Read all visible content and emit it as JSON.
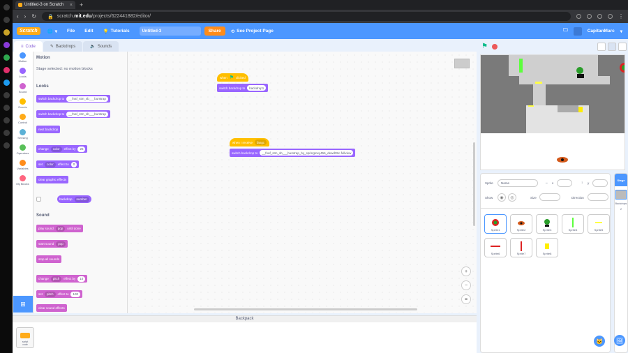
{
  "browser": {
    "tab_title": "Untitled-3 on Scratch",
    "tab_close": "×",
    "new_tab": "+",
    "url_prefix": "scratch.",
    "url_host": "mit.edu",
    "url_path": "/projects/622441882/editor/"
  },
  "menubar": {
    "logo": "Scratch",
    "file": "File",
    "edit": "Edit",
    "tutorials": "Tutorials",
    "project_title": "Untitled-3",
    "share": "Share",
    "see_project": "See Project Page",
    "username": "CapitanMarc"
  },
  "editor_tabs": {
    "code": "Code",
    "costumes": "Backdrops",
    "sounds": "Sounds"
  },
  "categories": [
    {
      "label": "Motion",
      "color": "#4c97ff"
    },
    {
      "label": "Looks",
      "color": "#9966ff"
    },
    {
      "label": "Sound",
      "color": "#cf63cf"
    },
    {
      "label": "Events",
      "color": "#ffbf00"
    },
    {
      "label": "Control",
      "color": "#ffab19"
    },
    {
      "label": "Sensing",
      "color": "#5cb1d6"
    },
    {
      "label": "Operators",
      "color": "#59c059"
    },
    {
      "label": "Variables",
      "color": "#ff8c1a"
    },
    {
      "label": "My Blocks",
      "color": "#ff6680"
    }
  ],
  "palette": {
    "motion_heading": "Motion",
    "motion_note": "Stage selected: no motion blocks",
    "looks_heading": "Looks",
    "sound_heading": "Sound",
    "b1": "switch backdrop to",
    "b1_val": "__fnaf_stm_sb___bumtrap",
    "b2": "switch backdrop to",
    "b2_val": "__fnaf_stm_sb___bumtrap",
    "b3": "next backdrop",
    "b4a": "change",
    "b4_dd": "color",
    "b4b": "effect by",
    "b4_val": "25",
    "b5a": "set",
    "b5_dd": "color",
    "b5b": "effect to",
    "b5_val": "0",
    "b6": "clear graphic effects",
    "b7": "backdrop",
    "b7_dd": "number",
    "s1": "play sound",
    "s1_dd": "pop",
    "s1b": "until done",
    "s2": "start sound",
    "s2_dd": "pop",
    "s3": "stop all sounds",
    "s4a": "change",
    "s4_dd": "pitch",
    "s4b": "effect by",
    "s4_val": "10",
    "s5a": "set",
    "s5_dd": "pitch",
    "s5b": "effect to",
    "s5_val": "100",
    "s6": "clear sound effects"
  },
  "script": {
    "hat1_when": "when",
    "hat1_clicked": "clicked",
    "blk1": "switch backdrop to",
    "blk1_val": "backdrop1",
    "hat2": "when I receive",
    "hat2_val": "fangc",
    "blk2": "switch backdrop to",
    "blk2_val": "__fnaf_stm_sb___bumtrap_by_springtoxy456_dewd35c-fullview"
  },
  "zoom": {
    "in": "+",
    "out": "−",
    "reset": "="
  },
  "backpack": {
    "title": "Backpack",
    "item_label": "script\ncode"
  },
  "sprite_info": {
    "sprite_label": "Sprite",
    "name_placeholder": "Name",
    "x_label": "x",
    "y_label": "y",
    "show_label": "Show",
    "size_label": "Size",
    "direction_label": "Direction"
  },
  "sprites": [
    "Sprite1",
    "Sprite2",
    "Sprite3",
    "Sprite4",
    "Sprite5",
    "Sprite6",
    "Sprite7",
    "Sprite8"
  ],
  "stage_pane": {
    "title": "Stage",
    "backdrops_label": "Backdrops",
    "backdrops_count": "2"
  }
}
